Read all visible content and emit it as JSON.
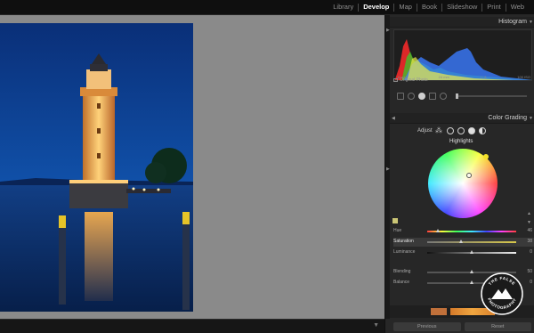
{
  "top_nav": {
    "modules": [
      "Library",
      "Develop",
      "Map",
      "Book",
      "Slideshow",
      "Print",
      "Web"
    ],
    "active": "Develop"
  },
  "histogram": {
    "title": "Histogram",
    "info": [
      "10 sek",
      "24 mm",
      "f / 8",
      "100 ISO"
    ],
    "original_photo_label": "Original Photo"
  },
  "color_grading": {
    "title": "Color Grading",
    "adjust_label": "Adjust",
    "wheel_title": "Highlights",
    "params": [
      {
        "label": "Hue",
        "value": "46",
        "fraction": 0.12
      },
      {
        "label": "Saturation",
        "value": "38",
        "fraction": 0.38
      },
      {
        "label": "Luminance",
        "value": "0",
        "fraction": 0.5
      },
      {
        "label": "Blending",
        "value": "50",
        "fraction": 0.5
      },
      {
        "label": "Balance",
        "value": "0",
        "fraction": 0.5
      }
    ]
  },
  "buttons": {
    "previous": "Previous",
    "reset": "Reset"
  },
  "watermark": {
    "text": "THE FALSE PHOTOGRAPHY"
  },
  "colors": {
    "accent_yellow": "#f3e12b",
    "sky": "#0e3c8c",
    "panel_bg": "#272727"
  }
}
